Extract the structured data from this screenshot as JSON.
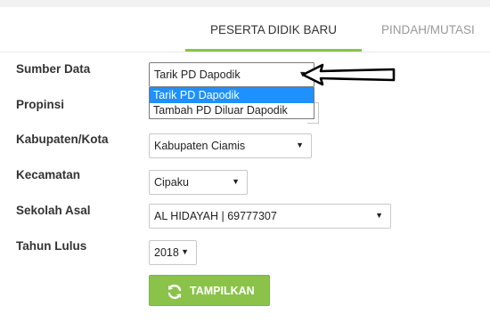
{
  "tabs": {
    "active": "PESERTA DIDIK BARU",
    "inactive": "PINDAH/MUTASI"
  },
  "form": {
    "sumber_data": {
      "label": "Sumber Data",
      "value": "Tarik PD Dapodik",
      "options": [
        "Tarik PD Dapodik",
        "Tambah PD Diluar Dapodik"
      ]
    },
    "propinsi": {
      "label": "Propinsi"
    },
    "kabupaten": {
      "label": "Kabupaten/Kota",
      "value": "Kabupaten Ciamis"
    },
    "kecamatan": {
      "label": "Kecamatan",
      "value": "Cipaku"
    },
    "sekolah": {
      "label": "Sekolah Asal",
      "value": "AL HIDAYAH | 69777307"
    },
    "tahun": {
      "label": "Tahun Lulus",
      "value": "2018"
    }
  },
  "button": {
    "label": "TAMPILKAN",
    "icon": "refresh-icon"
  },
  "colors": {
    "accent": "#8bc34a",
    "highlight": "#1e90ff"
  }
}
